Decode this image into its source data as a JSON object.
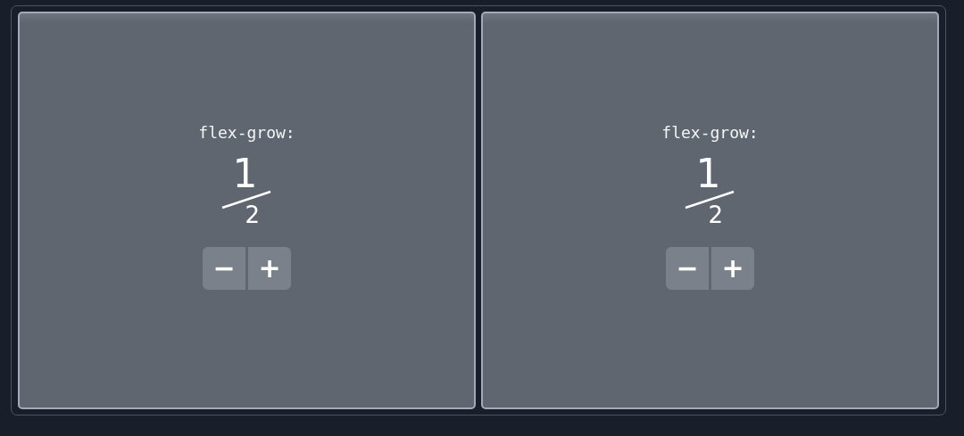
{
  "panels": [
    {
      "label": "flex-grow:",
      "numerator": "1",
      "denominator": "2",
      "buttons": [
        "−",
        "+"
      ]
    },
    {
      "label": "flex-grow:",
      "numerator": "1",
      "denominator": "2",
      "buttons": [
        "−",
        "+"
      ]
    }
  ]
}
